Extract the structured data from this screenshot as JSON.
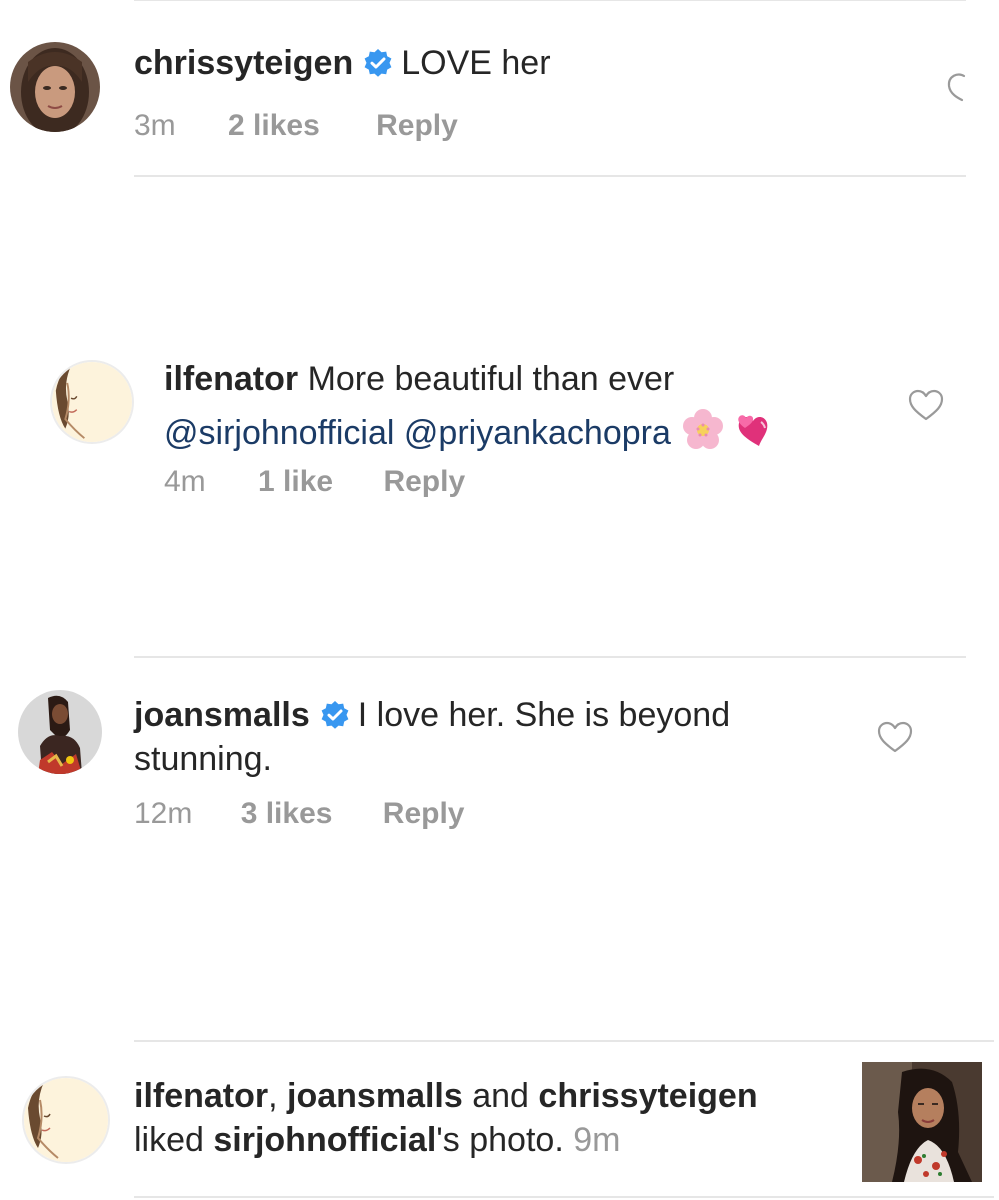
{
  "comments": [
    {
      "username": "chrissyteigen",
      "verified": true,
      "text": "LOVE her",
      "time": "3m",
      "likes": "2 likes",
      "reply": "Reply",
      "avatar_icon": "profile-photo-icon"
    },
    {
      "username": "ilfenator",
      "verified": false,
      "text": "More beautiful than ever",
      "mentions": [
        "@sirjohnofficial",
        "@priyankachopra"
      ],
      "emojis": [
        "cherry-blossom-emoji",
        "revolving-hearts-emoji"
      ],
      "time": "4m",
      "likes": "1 like",
      "reply": "Reply",
      "avatar_icon": "sketch-avatar-icon"
    },
    {
      "username": "joansmalls",
      "verified": true,
      "text_line1": "I love her. She is beyond",
      "text_line2": "stunning.",
      "time": "12m",
      "likes": "3 likes",
      "reply": "Reply",
      "avatar_icon": "profile-photo-icon"
    }
  ],
  "activity": {
    "user1": "ilfenator",
    "sep1": ", ",
    "user2": "joansmalls",
    "sep2": " and ",
    "user3": "chrissyteigen",
    "liked": "liked ",
    "owner": "sirjohnofficial",
    "suffix": "'s photo.",
    "time": "9m",
    "thumbnail_icon": "photo-thumbnail-icon"
  },
  "colors": {
    "text": "#262626",
    "meta": "#999999",
    "mention": "#1b3b66",
    "verified": "#3897f0",
    "divider": "#e6e6e6"
  }
}
